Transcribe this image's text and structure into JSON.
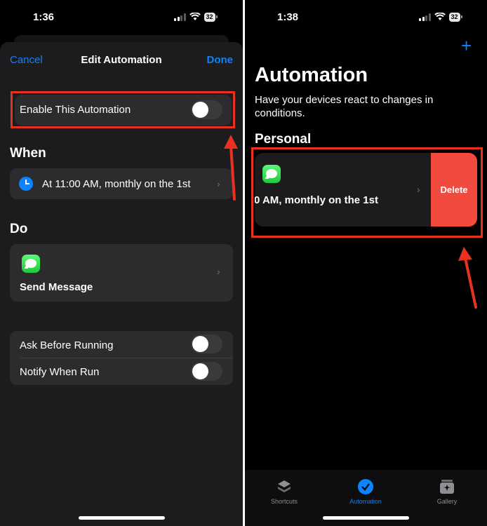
{
  "left": {
    "status": {
      "time": "1:36",
      "battery": "32"
    },
    "nav": {
      "cancel": "Cancel",
      "title": "Edit Automation",
      "done": "Done"
    },
    "enable_row": {
      "label": "Enable This Automation",
      "enabled": false
    },
    "when": {
      "heading": "When",
      "trigger": "At 11:00 AM, monthly on the 1st",
      "icon": "clock-icon"
    },
    "do": {
      "heading": "Do",
      "action": "Send Message",
      "icon": "messages-app-icon"
    },
    "options": [
      {
        "label": "Ask Before Running",
        "enabled": false
      },
      {
        "label": "Notify When Run",
        "enabled": false
      }
    ]
  },
  "right": {
    "status": {
      "time": "1:38",
      "battery": "32"
    },
    "add_icon": "+",
    "title": "Automation",
    "subtitle": "Have your devices react to changes in conditions.",
    "section": "Personal",
    "automation": {
      "text": "0 AM, monthly on the 1st",
      "icon": "messages-app-icon"
    },
    "delete_label": "Delete",
    "tabs": [
      {
        "label": "Shortcuts",
        "icon": "shortcuts-icon",
        "active": false
      },
      {
        "label": "Automation",
        "icon": "automation-icon",
        "active": true
      },
      {
        "label": "Gallery",
        "icon": "gallery-icon",
        "active": false
      }
    ]
  },
  "colors": {
    "accent": "#0a84ff",
    "delete": "#f24a3f",
    "annotation": "#e8321f",
    "card": "#2c2c2e"
  }
}
